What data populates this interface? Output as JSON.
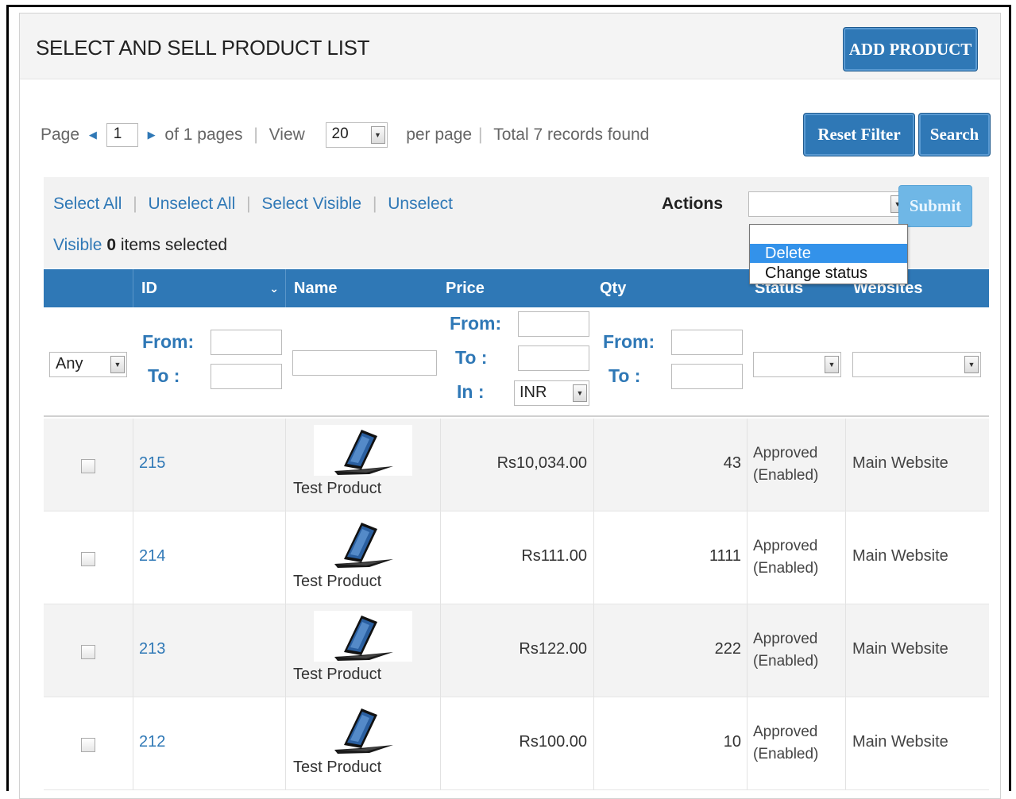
{
  "header": {
    "title": "SELECT AND SELL PRODUCT LIST",
    "add_product_label": "ADD PRODUCT"
  },
  "pager": {
    "page_label": "Page",
    "current_page": "1",
    "of_pages": "of 1 pages",
    "view_label": "View",
    "per_page_value": "20",
    "per_page_label": "per page",
    "total_text": "Total 7 records found"
  },
  "filter_buttons": {
    "reset_label": "Reset Filter",
    "search_label": "Search"
  },
  "mass_action": {
    "links": [
      "Select All",
      "Unselect All",
      "Select Visible",
      "Unselect"
    ],
    "visible_label": "Visible",
    "selected_count": "0",
    "selected_suffix": "items selected",
    "actions_label": "Actions",
    "actions_value": "",
    "submit_label": "Submit",
    "menu_options": [
      "",
      "Delete",
      "Change status"
    ],
    "highlighted_option": "Delete"
  },
  "columns": {
    "id": "ID",
    "id_sort_icon": "chevron-down-icon",
    "name": "Name",
    "price": "Price",
    "qty": "Qty",
    "status": "Status",
    "websites": "Websites"
  },
  "filters": {
    "any_value": "Any",
    "from_label": "From:",
    "to_label": "To :",
    "in_label": "In :",
    "currency_value": "INR"
  },
  "rows": [
    {
      "id": "215",
      "name": "Test Product",
      "price": "Rs10,034.00",
      "qty": "43",
      "status_1": "Approved",
      "status_2": "(Enabled)",
      "website": "Main Website"
    },
    {
      "id": "214",
      "name": "Test Product",
      "price": "Rs111.00",
      "qty": "1111",
      "status_1": "Approved",
      "status_2": "(Enabled)",
      "website": "Main Website"
    },
    {
      "id": "213",
      "name": "Test Product",
      "price": "Rs122.00",
      "qty": "222",
      "status_1": "Approved",
      "status_2": "(Enabled)",
      "website": "Main Website"
    },
    {
      "id": "212",
      "name": "Test Product",
      "price": "Rs100.00",
      "qty": "10",
      "status_1": "Approved",
      "status_2": "(Enabled)",
      "website": "Main Website"
    }
  ],
  "colors": {
    "brand_blue": "#2f78b6",
    "submit_blue": "#6fb7e6",
    "menu_highlight": "#3392ea"
  },
  "icons": {
    "product_thumb": "laptop-icon",
    "pager_prev": "triangle-left-icon",
    "pager_next": "triangle-right-icon",
    "select_arrow": "chevron-down-icon"
  }
}
